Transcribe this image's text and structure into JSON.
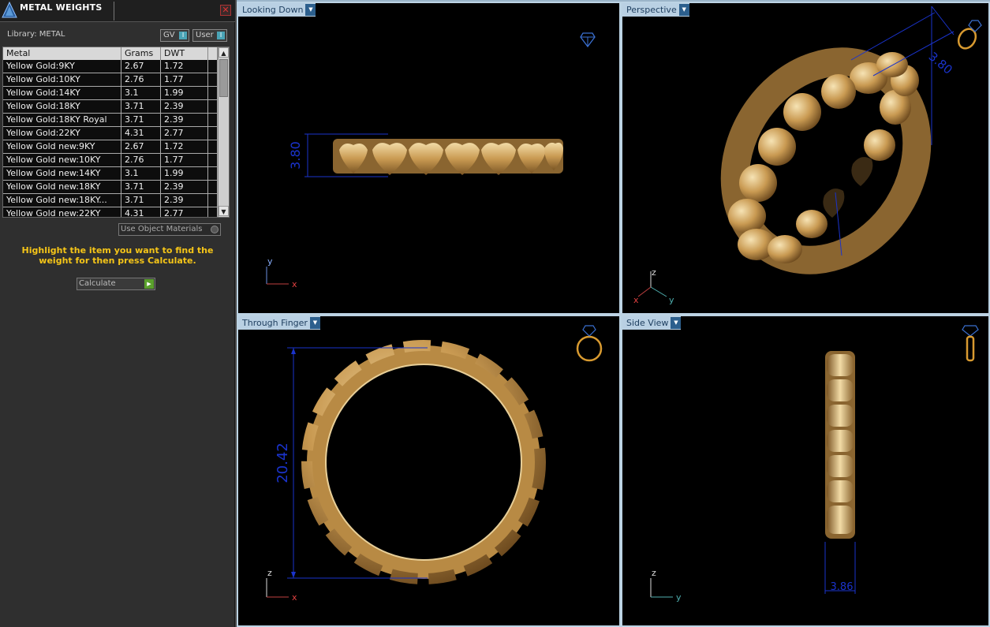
{
  "panel": {
    "title": "METAL WEIGHTS",
    "close_glyph": "✕",
    "library_label": "Library: METAL",
    "library_buttons": [
      {
        "label": "GV",
        "indicator": "I"
      },
      {
        "label": "User",
        "indicator": "I"
      }
    ],
    "table": {
      "headers": [
        "Metal",
        "Grams",
        "DWT"
      ],
      "rows": [
        [
          "Yellow Gold:9KY",
          "2.67",
          "1.72"
        ],
        [
          "Yellow Gold:10KY",
          "2.76",
          "1.77"
        ],
        [
          "Yellow Gold:14KY",
          "3.1",
          "1.99"
        ],
        [
          "Yellow Gold:18KY",
          "3.71",
          "2.39"
        ],
        [
          "Yellow Gold:18KY Royal",
          "3.71",
          "2.39"
        ],
        [
          "Yellow Gold:22KY",
          "4.31",
          "2.77"
        ],
        [
          "Yellow Gold new:9KY",
          "2.67",
          "1.72"
        ],
        [
          "Yellow Gold new:10KY",
          "2.76",
          "1.77"
        ],
        [
          "Yellow Gold new:14KY",
          "3.1",
          "1.99"
        ],
        [
          "Yellow Gold new:18KY",
          "3.71",
          "2.39"
        ],
        [
          "Yellow Gold new:18KY...",
          "3.71",
          "2.39"
        ],
        [
          "Yellow Gold new:22KY",
          "4.31",
          "2.77"
        ]
      ]
    },
    "use_object_materials": "Use Object Materials",
    "hint": "Highlight the item you want to find the weight for then press Calculate.",
    "calculate_label": "Calculate"
  },
  "viewports": {
    "looking_down": {
      "label": "Looking Down",
      "dimension": "3.80",
      "axis_up": "y",
      "axis_right": "x",
      "icon": "gem-icon"
    },
    "perspective": {
      "label": "Perspective",
      "dimension": "3.80",
      "axis_up": "z",
      "axis_left": "x",
      "axis_right": "y",
      "icon": "ring-perspective-icon"
    },
    "through_finger": {
      "label": "Through Finger",
      "dimension": "20.42",
      "axis_up": "z",
      "axis_right": "x",
      "icon": "ring-front-icon"
    },
    "side_view": {
      "label": "Side View",
      "dimension": "3.86",
      "axis_up": "z",
      "axis_right": "y",
      "icon": "ring-side-icon"
    }
  },
  "colors": {
    "viewport_border": "#bcd3e4",
    "viewport_label_bg": "#b9d0e3",
    "gold": "#c9a05a",
    "dimension_blue": "#1a33cc",
    "hint_yellow": "#f5c518"
  }
}
